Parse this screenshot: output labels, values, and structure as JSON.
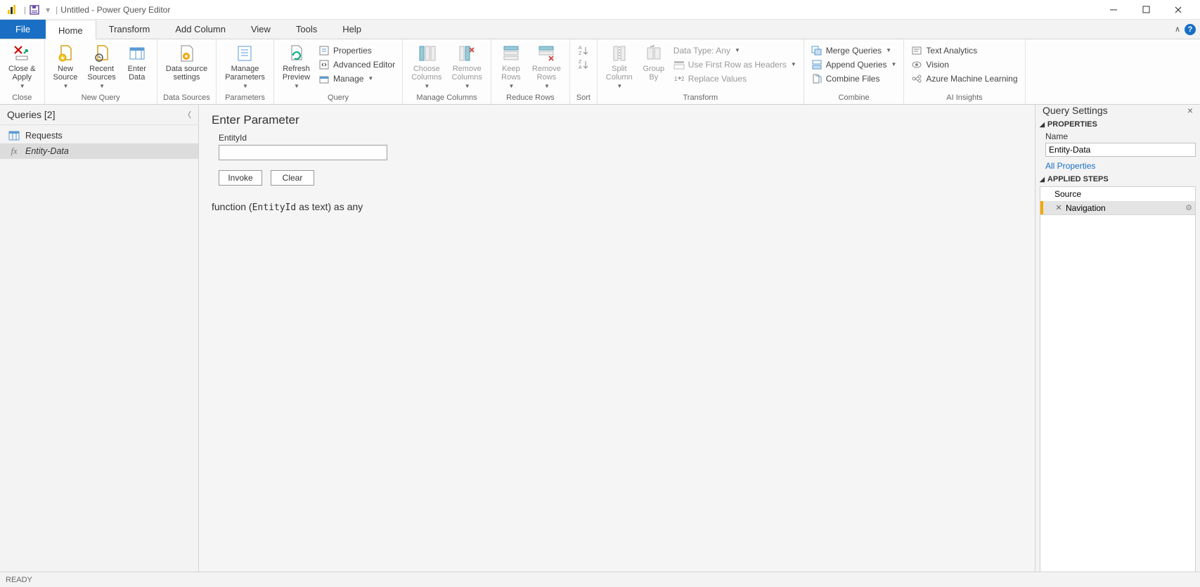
{
  "title": "Untitled - Power Query Editor",
  "tabs": {
    "file": "File",
    "home": "Home",
    "transform": "Transform",
    "addcol": "Add Column",
    "view": "View",
    "tools": "Tools",
    "help": "Help"
  },
  "ribbon": {
    "close": {
      "label": "Close &\nApply",
      "group": "Close"
    },
    "newquery": {
      "new": "New\nSource",
      "recent": "Recent\nSources",
      "enter": "Enter\nData",
      "group": "New Query"
    },
    "datasrc": {
      "settings": "Data source\nsettings",
      "group": "Data Sources"
    },
    "params": {
      "manage": "Manage\nParameters",
      "group": "Parameters"
    },
    "query": {
      "refresh": "Refresh\nPreview",
      "props": "Properties",
      "advanced": "Advanced Editor",
      "manage": "Manage",
      "group": "Query"
    },
    "cols": {
      "choose": "Choose\nColumns",
      "remove": "Remove\nColumns",
      "group": "Manage Columns"
    },
    "rows": {
      "keep": "Keep\nRows",
      "remove": "Remove\nRows",
      "group": "Reduce Rows"
    },
    "sort": {
      "group": "Sort"
    },
    "transform": {
      "split": "Split\nColumn",
      "groupby": "Group\nBy",
      "datatype": "Data Type: Any",
      "firstrow": "Use First Row as Headers",
      "replace": "Replace Values",
      "group": "Transform"
    },
    "combine": {
      "merge": "Merge Queries",
      "append": "Append Queries",
      "files": "Combine Files",
      "group": "Combine"
    },
    "ai": {
      "text": "Text Analytics",
      "vision": "Vision",
      "azure": "Azure Machine Learning",
      "group": "AI Insights"
    }
  },
  "queries": {
    "header": "Queries [2]",
    "items": [
      {
        "name": "Requests",
        "type": "table"
      },
      {
        "name": "Entity-Data",
        "type": "fx",
        "selected": true
      }
    ]
  },
  "center": {
    "title": "Enter Parameter",
    "paramlabel": "EntityId",
    "invoke": "Invoke",
    "clear": "Clear",
    "sig_prefix": "function (",
    "sig_param": "EntityId",
    "sig_as": " as text) as any"
  },
  "settings": {
    "title": "Query Settings",
    "props": "PROPERTIES",
    "namelabel": "Name",
    "namevalue": "Entity-Data",
    "allprops": "All Properties",
    "stepshead": "APPLIED STEPS",
    "steps": [
      {
        "name": "Source"
      },
      {
        "name": "Navigation",
        "selected": true
      }
    ]
  },
  "status": "READY"
}
